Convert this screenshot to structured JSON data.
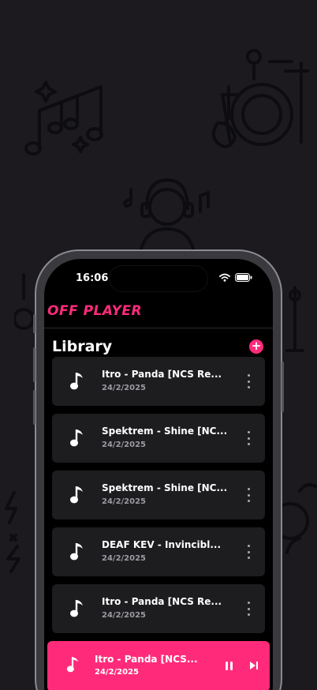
{
  "status_bar": {
    "time": "16:06"
  },
  "app": {
    "title": "OFF PLAYER"
  },
  "library": {
    "title": "Library",
    "add_icon": "plus-icon"
  },
  "tracks": [
    {
      "name": "Itro - Panda [NCS Re...",
      "date": "24/2/2025"
    },
    {
      "name": "Spektrem - Shine [NC...",
      "date": "24/2/2025"
    },
    {
      "name": "Spektrem - Shine [NC...",
      "date": "24/2/2025"
    },
    {
      "name": "DEAF KEV - Invincibl...",
      "date": "24/2/2025"
    },
    {
      "name": "Itro - Panda [NCS Re...",
      "date": "24/2/2025"
    }
  ],
  "now_playing": {
    "name": "Itro - Panda [NCS...",
    "date": "24/2/2025"
  },
  "colors": {
    "accent": "#ff2b7a",
    "card": "#1d1d20",
    "background": "#1c1a1f"
  }
}
